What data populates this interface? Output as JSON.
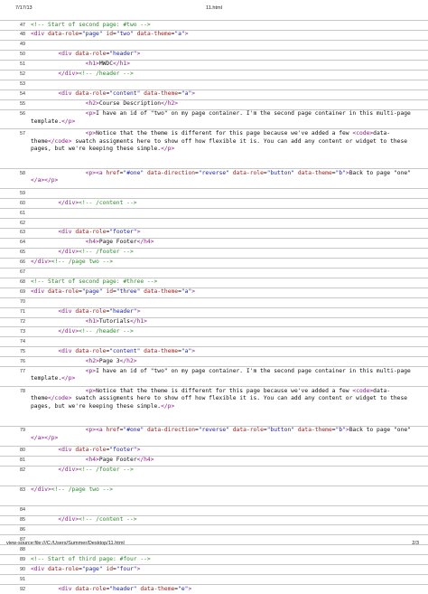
{
  "header": {
    "date": "7/17/13",
    "title": "11.html"
  },
  "footer": {
    "url": "view-source:file:///C:/Users/Summer/Desktop/11.html",
    "page": "2/3"
  },
  "lines": [
    {
      "n": "47",
      "rows": 1,
      "text": "<!-- Start of second page: #two -->"
    },
    {
      "n": "48",
      "rows": 1,
      "text": "<div data-role=\"page\" id=\"two\" data-theme=\"a\">"
    },
    {
      "n": "49",
      "rows": 1,
      "text": ""
    },
    {
      "n": "50",
      "rows": 1,
      "text": "        <div data-role=\"header\">"
    },
    {
      "n": "51",
      "rows": 1,
      "text": "                <h1>MWDC</h1>"
    },
    {
      "n": "52",
      "rows": 1,
      "text": "        </div><!-- /header -->"
    },
    {
      "n": "53",
      "rows": 1,
      "text": ""
    },
    {
      "n": "54",
      "rows": 1,
      "text": "        <div data-role=\"content\" data-theme=\"a\">"
    },
    {
      "n": "55",
      "rows": 1,
      "text": "                <h2>Course Description</h2>"
    },
    {
      "n": "56",
      "rows": 2,
      "text": "                <p>I have an id of \"two\" on my page container. I'm the second page container in this multi-page template.</p>"
    },
    {
      "n": "57",
      "rows": 4,
      "text": "                <p>Notice that the theme is different for this page because we've added a few <code>data-theme</code> swatch assigments here to show off how flexible it is. You can add any content or widget to these pages, but we're keeping these simple.</p>"
    },
    {
      "n": "58",
      "rows": 2,
      "text": "                <p><a href=\"#one\" data-direction=\"reverse\" data-role=\"button\" data-theme=\"b\">Back to page \"one\"</a></p>"
    },
    {
      "n": "59",
      "rows": 1,
      "text": ""
    },
    {
      "n": "60",
      "rows": 1,
      "text": "        </div><!-- /content -->"
    },
    {
      "n": "61",
      "rows": 1,
      "text": ""
    },
    {
      "n": "62",
      "rows": 1,
      "text": ""
    },
    {
      "n": "63",
      "rows": 1,
      "text": "        <div data-role=\"footer\">"
    },
    {
      "n": "64",
      "rows": 1,
      "text": "                <h4>Page Footer</h4>"
    },
    {
      "n": "65",
      "rows": 1,
      "text": "        </div><!-- /footer -->"
    },
    {
      "n": "66",
      "rows": 1,
      "text": "</div><!-- /page two -->"
    },
    {
      "n": "67",
      "rows": 1,
      "text": ""
    },
    {
      "n": "68",
      "rows": 1,
      "text": "<!-- Start of second page: #three -->"
    },
    {
      "n": "69",
      "rows": 1,
      "text": "<div data-role=\"page\" id=\"three\" data-theme=\"a\">"
    },
    {
      "n": "70",
      "rows": 1,
      "text": ""
    },
    {
      "n": "71",
      "rows": 1,
      "text": "        <div data-role=\"header\">"
    },
    {
      "n": "72",
      "rows": 1,
      "text": "                <h1>Tutorials</h1>"
    },
    {
      "n": "73",
      "rows": 1,
      "text": "        </div><!-- /header -->"
    },
    {
      "n": "74",
      "rows": 1,
      "text": ""
    },
    {
      "n": "75",
      "rows": 1,
      "text": "        <div data-role=\"content\" data-theme=\"a\">"
    },
    {
      "n": "76",
      "rows": 1,
      "text": "                <h2>Page 3</h2>"
    },
    {
      "n": "77",
      "rows": 2,
      "text": "                <p>I have an id of \"two\" on my page container. I'm the second page container in this multi-page template.</p>"
    },
    {
      "n": "78",
      "rows": 4,
      "text": "                <p>Notice that the theme is different for this page because we've added a few <code>data-theme</code> swatch assigments here to show off how flexible it is. You can add any content or widget to these pages, but we're keeping these simple.</p>"
    },
    {
      "n": "79",
      "rows": 2,
      "text": "                <p><a href=\"#one\" data-direction=\"reverse\" data-role=\"button\" data-theme=\"b\">Back to page \"one\"</a></p>"
    },
    {
      "n": "80",
      "rows": 1,
      "text": "        <div data-role=\"footer\">"
    },
    {
      "n": "81",
      "rows": 1,
      "text": "                <h4>Page Footer</h4>"
    },
    {
      "n": "82",
      "rows": 2,
      "text": "        </div><!-- /footer -->"
    },
    {
      "n": "83",
      "rows": 2,
      "text": "</div><!-- /page two -->"
    },
    {
      "n": "84",
      "rows": 1,
      "text": ""
    },
    {
      "n": "85",
      "rows": 1,
      "text": "        </div><!-- /content -->"
    },
    {
      "n": "86",
      "rows": 1,
      "text": ""
    },
    {
      "n": "87",
      "rows": 1,
      "text": ""
    },
    {
      "n": "88",
      "rows": 1,
      "text": ""
    },
    {
      "n": "89",
      "rows": 1,
      "text": "<!-- Start of third page: #four -->"
    },
    {
      "n": "90",
      "rows": 1,
      "text": "<div data-role=\"page\" id=\"four\">"
    },
    {
      "n": "91",
      "rows": 1,
      "text": ""
    },
    {
      "n": "92",
      "rows": 1,
      "text": "        <div data-role=\"header\" data-theme=\"e\">"
    }
  ]
}
